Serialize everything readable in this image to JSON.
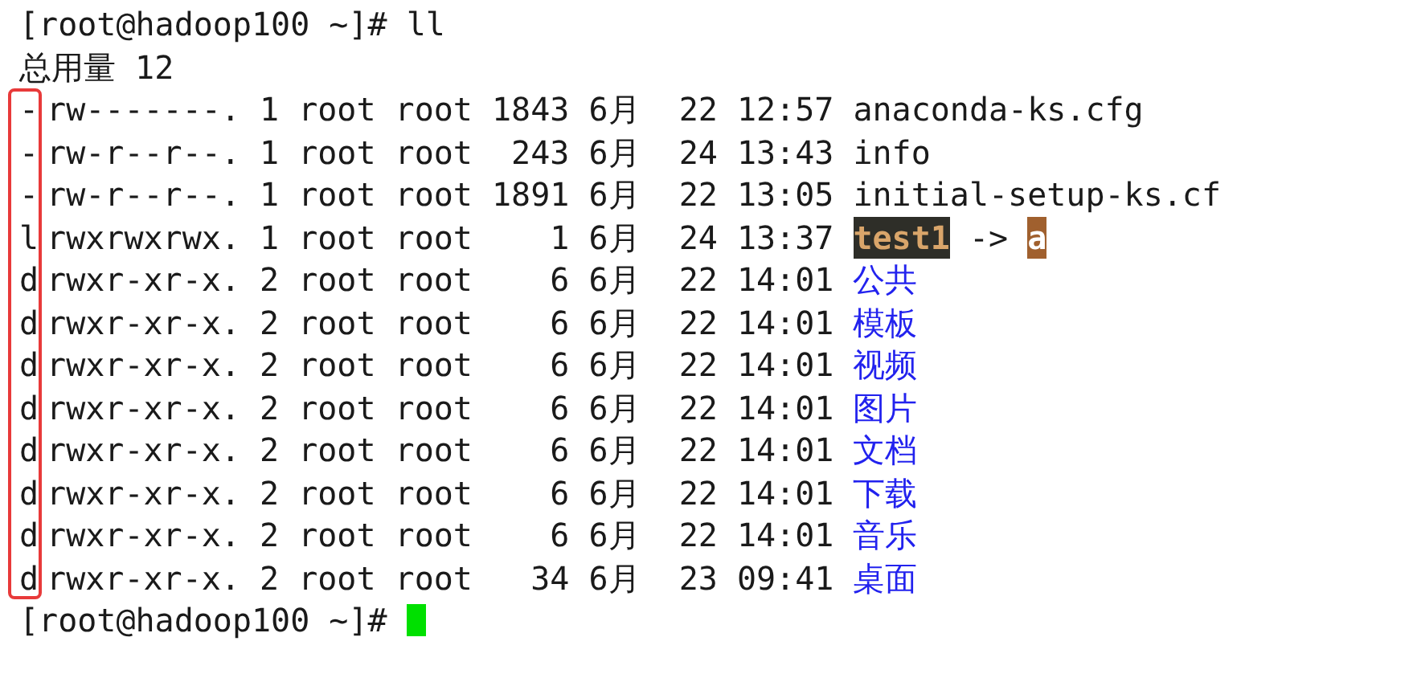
{
  "prompt": {
    "text": "[root@hadoop100 ~]# ll"
  },
  "total": {
    "text": "总用量 12"
  },
  "entries": [
    {
      "kind": "file",
      "type": "-",
      "perms": "rw-------.",
      "links": "1",
      "owner": "root",
      "group": "root",
      "size": "1843",
      "month": "6月",
      "day": "22",
      "time": "12:57",
      "name": "anaconda-ks.cfg"
    },
    {
      "kind": "file",
      "type": "-",
      "perms": "rw-r--r--.",
      "links": "1",
      "owner": "root",
      "group": "root",
      "size": "243",
      "month": "6月",
      "day": "24",
      "time": "13:43",
      "name": "info"
    },
    {
      "kind": "file",
      "type": "-",
      "perms": "rw-r--r--.",
      "links": "1",
      "owner": "root",
      "group": "root",
      "size": "1891",
      "month": "6月",
      "day": "22",
      "time": "13:05",
      "name": "initial-setup-ks.cf"
    },
    {
      "kind": "link",
      "type": "l",
      "perms": "rwxrwxrwx.",
      "links": "1",
      "owner": "root",
      "group": "root",
      "size": "1",
      "month": "6月",
      "day": "24",
      "time": "13:37",
      "name": "test1",
      "arrow": "->",
      "target": "a"
    },
    {
      "kind": "dir",
      "type": "d",
      "perms": "rwxr-xr-x.",
      "links": "2",
      "owner": "root",
      "group": "root",
      "size": "6",
      "month": "6月",
      "day": "22",
      "time": "14:01",
      "name": "公共"
    },
    {
      "kind": "dir",
      "type": "d",
      "perms": "rwxr-xr-x.",
      "links": "2",
      "owner": "root",
      "group": "root",
      "size": "6",
      "month": "6月",
      "day": "22",
      "time": "14:01",
      "name": "模板"
    },
    {
      "kind": "dir",
      "type": "d",
      "perms": "rwxr-xr-x.",
      "links": "2",
      "owner": "root",
      "group": "root",
      "size": "6",
      "month": "6月",
      "day": "22",
      "time": "14:01",
      "name": "视频"
    },
    {
      "kind": "dir",
      "type": "d",
      "perms": "rwxr-xr-x.",
      "links": "2",
      "owner": "root",
      "group": "root",
      "size": "6",
      "month": "6月",
      "day": "22",
      "time": "14:01",
      "name": "图片"
    },
    {
      "kind": "dir",
      "type": "d",
      "perms": "rwxr-xr-x.",
      "links": "2",
      "owner": "root",
      "group": "root",
      "size": "6",
      "month": "6月",
      "day": "22",
      "time": "14:01",
      "name": "文档"
    },
    {
      "kind": "dir",
      "type": "d",
      "perms": "rwxr-xr-x.",
      "links": "2",
      "owner": "root",
      "group": "root",
      "size": "6",
      "month": "6月",
      "day": "22",
      "time": "14:01",
      "name": "下载"
    },
    {
      "kind": "dir",
      "type": "d",
      "perms": "rwxr-xr-x.",
      "links": "2",
      "owner": "root",
      "group": "root",
      "size": "6",
      "month": "6月",
      "day": "22",
      "time": "14:01",
      "name": "音乐"
    },
    {
      "kind": "dir",
      "type": "d",
      "perms": "rwxr-xr-x.",
      "links": "2",
      "owner": "root",
      "group": "root",
      "size": "34",
      "month": "6月",
      "day": "23",
      "time": "09:41",
      "name": "桌面"
    }
  ],
  "next_prompt": {
    "text": "[root@hadoop100 ~]#"
  }
}
